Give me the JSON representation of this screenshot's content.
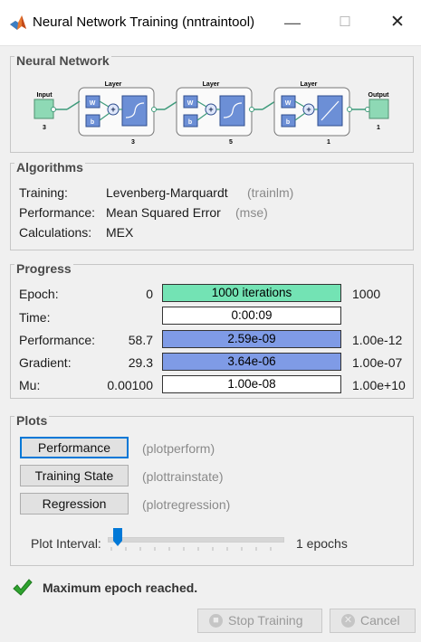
{
  "window": {
    "title": "Neural Network Training (nntraintool)"
  },
  "network": {
    "section_title": "Neural Network",
    "input_label": "Input",
    "input_size": "3",
    "output_label": "Output",
    "output_size": "1",
    "layer_label": "Layer",
    "weight_label": "W",
    "bias_label": "b",
    "layers": [
      {
        "size": "3"
      },
      {
        "size": "5"
      },
      {
        "size": "1"
      }
    ]
  },
  "algorithms": {
    "section_title": "Algorithms",
    "rows": [
      {
        "label": "Training:",
        "value": "Levenberg-Marquardt",
        "code": "(trainlm)"
      },
      {
        "label": "Performance:",
        "value": "Mean Squared Error",
        "code": "(mse)"
      },
      {
        "label": "Calculations:",
        "value": "MEX",
        "code": ""
      }
    ]
  },
  "progress": {
    "section_title": "Progress",
    "rows": [
      {
        "label": "Epoch:",
        "start": "0",
        "current": "1000 iterations",
        "target": "1000",
        "fill": 1.0
      },
      {
        "label": "Time:",
        "start": "",
        "current": "0:00:09",
        "target": "",
        "fill": 0.0
      },
      {
        "label": "Performance:",
        "start": "58.7",
        "current": "2.59e-09",
        "target": "1.00e-12",
        "fill": 1.0
      },
      {
        "label": "Gradient:",
        "start": "29.3",
        "current": "3.64e-06",
        "target": "1.00e-07",
        "fill": 1.0
      },
      {
        "label": "Mu:",
        "start": "0.00100",
        "current": "1.00e-08",
        "target": "1.00e+10",
        "fill": 0.0
      }
    ]
  },
  "plots": {
    "section_title": "Plots",
    "buttons": [
      {
        "label": "Performance",
        "func": "(plotperform)"
      },
      {
        "label": "Training State",
        "func": "(plottrainstate)"
      },
      {
        "label": "Regression",
        "func": "(plotregression)"
      }
    ],
    "interval_label": "Plot Interval:",
    "interval_value": "1 epochs",
    "interval_fraction": 0.0
  },
  "status": {
    "message": "Maximum epoch reached."
  },
  "buttons": {
    "stop": "Stop Training",
    "cancel": "Cancel"
  },
  "colors": {
    "epoch_fill": "#73e3b4",
    "perf_fill": "#7f9be6",
    "focus": "#0078d7",
    "check": "#2fa32f"
  }
}
